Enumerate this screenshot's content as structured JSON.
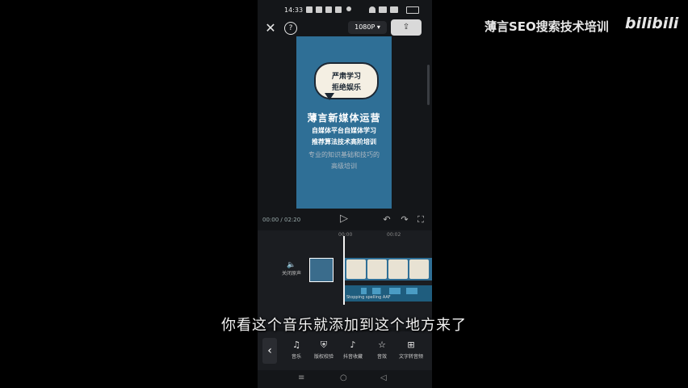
{
  "status_bar": {
    "time": "14:33"
  },
  "top_bar": {
    "close_icon": "✕",
    "help_icon": "?",
    "resolution": "1080P ▾",
    "export_label": "⇪"
  },
  "preview": {
    "bubble_line1": "严肃学习",
    "bubble_line2": "拒绝娱乐",
    "title": "薄言新媒体运营",
    "line1": "自媒体平台自媒体学习",
    "line2": "推荐算法技术高阶培训",
    "line3": "专业的知识基础和技巧的",
    "line4": "高级培训"
  },
  "playback": {
    "current_time": "00:00",
    "total_time": "02:20",
    "play_icon": "▷",
    "undo_icon": "↶",
    "redo_icon": "↷",
    "fullscreen_icon": "⛶"
  },
  "timeline": {
    "ruler_marks": [
      "00:00",
      "00:02"
    ],
    "audio_toggle_icon": "🔈",
    "audio_toggle_label": "关闭原声",
    "music_label": "Stopping spelling AAF"
  },
  "subtitle": "你看这个音乐就添加到这个地方来了",
  "toolbar": {
    "back_icon": "‹",
    "items": [
      {
        "icon": "♫",
        "label": "音乐"
      },
      {
        "icon": "⛨",
        "label": "版权校验"
      },
      {
        "icon": "♪",
        "label": "抖音收藏"
      },
      {
        "icon": "☆",
        "label": "音效"
      },
      {
        "icon": "⊞",
        "label": "文字转音频"
      }
    ]
  },
  "nav_bar": {
    "menu_icon": "≡",
    "home_icon": "○",
    "back_icon": "◁"
  },
  "watermark": {
    "text": "薄言SEO搜索技术培训",
    "logo": "bilibili"
  }
}
